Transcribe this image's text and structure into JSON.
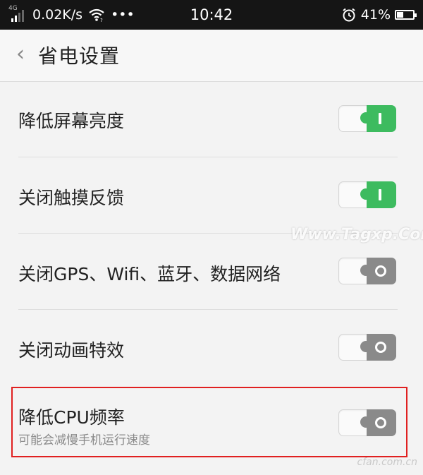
{
  "status_bar": {
    "network_type": "4G",
    "speed": "0.02K/s",
    "more": "•••",
    "time": "10:42",
    "battery_percent": "41%",
    "battery_level": 0.41,
    "icons": [
      "signal-icon",
      "wifi-icon",
      "alarm-icon",
      "battery-icon"
    ]
  },
  "header": {
    "back_glyph": "‹",
    "title": "省电设置"
  },
  "settings": [
    {
      "label": "降低屏幕亮度",
      "on": true
    },
    {
      "label": "关闭触摸反馈",
      "on": true
    },
    {
      "label": "关闭GPS、Wifi、蓝牙、数据网络",
      "on": false
    },
    {
      "label": "关闭动画特效",
      "on": false
    },
    {
      "label": "降低CPU频率",
      "sublabel": "可能会减慢手机运行速度",
      "on": false
    }
  ],
  "watermark": "Www.Tagxp.Com",
  "corner_mark": "cfan.com.cn",
  "colors": {
    "toggle_on": "#3dbb5f",
    "toggle_off": "#8a8a8a",
    "highlight_border": "#e02020",
    "status_bar_bg": "#151515"
  }
}
